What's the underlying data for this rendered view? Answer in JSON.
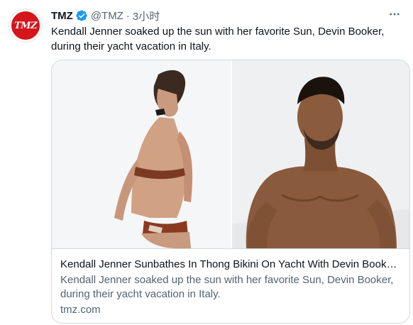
{
  "tweet": {
    "author_name": "TMZ",
    "handle": "@TMZ",
    "separator": "·",
    "time": "3小时",
    "text": "Kendall Jenner soaked up the sun with her favorite Sun, Devin Booker, during their yacht vacation in Italy.",
    "avatar_label": "TMZ"
  },
  "card": {
    "title": "Kendall Jenner Sunbathes In Thong Bikini On Yacht With Devin Booker...",
    "description": "Kendall Jenner soaked up the sun with her favorite Sun, Devin Booker, during their yacht vacation in Italy.",
    "domain": "tmz.com"
  },
  "colors": {
    "verified": "#1d9bf0",
    "brand": "#d6141c",
    "secondary_text": "#536471",
    "border": "#cfd9de"
  },
  "icons": [
    "verified-badge-icon",
    "more-options-icon"
  ]
}
